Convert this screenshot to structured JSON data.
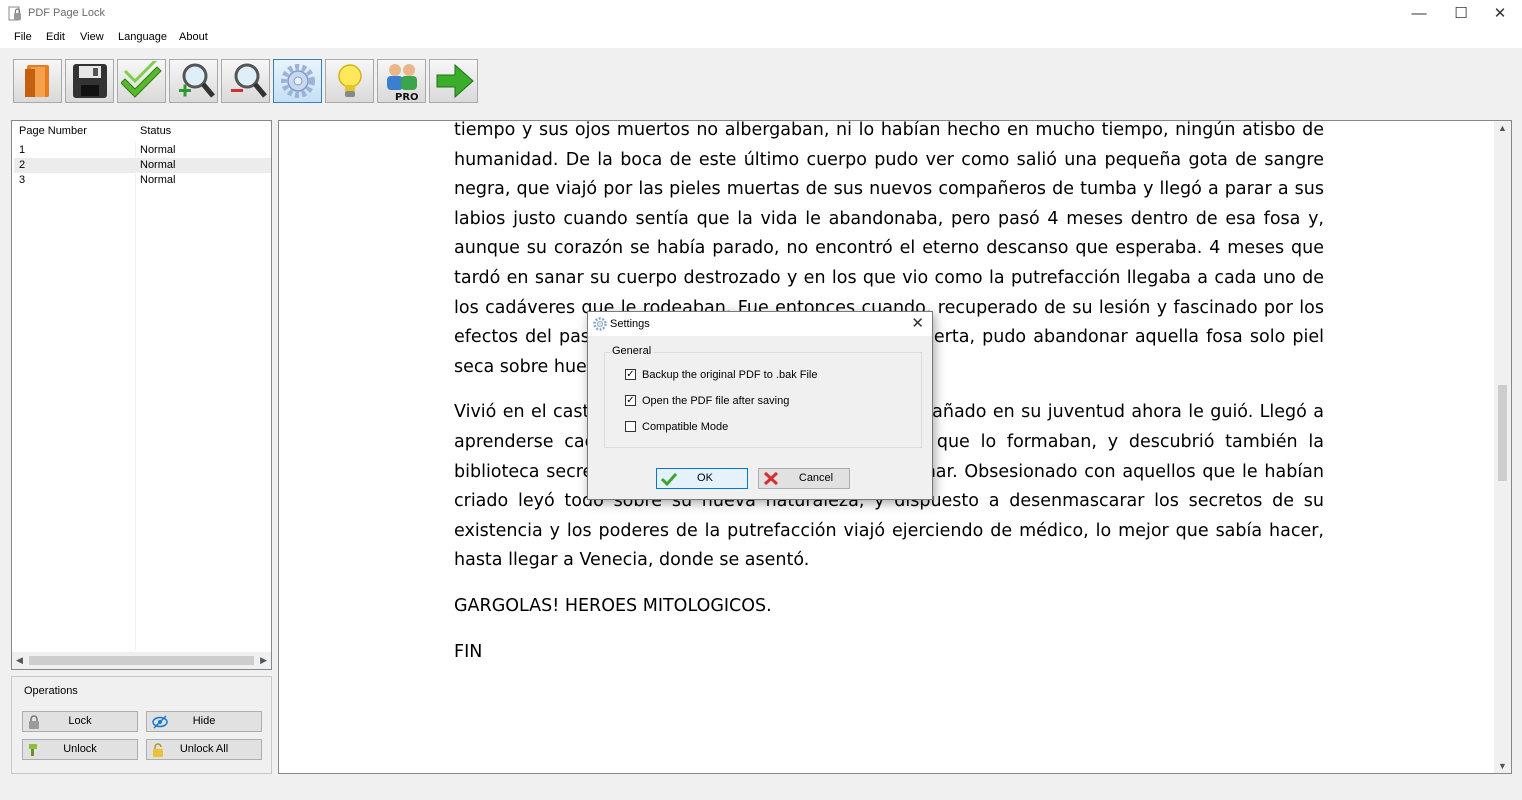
{
  "window": {
    "title": "PDF Page Lock",
    "minimize": "—",
    "maximize": "☐",
    "close": "✕"
  },
  "menu": [
    "File",
    "Edit",
    "View",
    "Language",
    "About"
  ],
  "toolbar": {
    "buttons": [
      "open-icon",
      "save-icon",
      "apply-check-icon",
      "zoom-in-icon",
      "zoom-out-icon",
      "settings-gear-icon",
      "tips-lightbulb-icon",
      "pro-users-icon",
      "next-arrow-icon"
    ],
    "active": "settings-gear-icon"
  },
  "page_list": {
    "columns": [
      "Page Number",
      "Status"
    ],
    "rows": [
      {
        "page": "1",
        "status": "Normal"
      },
      {
        "page": "2",
        "status": "Normal"
      },
      {
        "page": "3",
        "status": "Normal"
      }
    ],
    "selected_row": "2"
  },
  "operations": {
    "title": "Operations",
    "lock": "Lock",
    "hide": "Hide",
    "unlock": "Unlock",
    "unlock_all": "Unlock All"
  },
  "document": {
    "paragraphs": [
      "tiempo y sus ojos muertos no albergaban, ni lo habían hecho en mucho tiempo, ningún atisbo de humanidad. De la boca de este último cuerpo pudo ver como salió una pequeña gota de sangre negra, que viajó por las pieles muertas de sus nuevos compañeros de tumba y llegó a parar a sus labios justo cuando sentía que la vida le abandonaba, pero pasó 4 meses dentro de esa fosa y, aunque su corazón se había parado, no encontró el eterno descanso que esperaba. 4 meses que tardó en sanar su cuerpo destrozado y en los que vio como la putrefacción llegaba a cada uno de los cadáveres que le rodeaban. Fue entonces cuando, recuperado de su lesión y fascinado por los efectos del paso del tiempo sobre la carne viva o muerta, pudo abandonar aquella fosa solo piel seca sobre hueso, y liberarse de su prisión mortal.",
      "Vivió en el castillo, y la presencia que la había acompañado en su juventud ahora le guió. Llegó a aprenderse cada fisura en la roca de cada piedra que lo formaban, y descubrió también la biblioteca secreta que los soldados no pudieron quemar. Obsesionado con aquellos que le habían criado leyó todo sobre su nueva naturaleza, y dispuesto a desenmascarar los secretos de su existencia y los poderes de la putrefacción viajó ejerciendo de médico, lo mejor que sabía hacer, hasta llegar a Venecia, donde se asentó.",
      "GARGOLAS! HEROES MITOLOGICOS.",
      "FIN"
    ]
  },
  "settings_dialog": {
    "title": "Settings",
    "group_label": "General",
    "options": [
      {
        "label": "Backup the original PDF to .bak File",
        "checked": true
      },
      {
        "label": "Open the PDF file after saving",
        "checked": true
      },
      {
        "label": "Compatible Mode",
        "checked": false
      }
    ],
    "ok": "OK",
    "cancel": "Cancel",
    "close": "✕"
  }
}
